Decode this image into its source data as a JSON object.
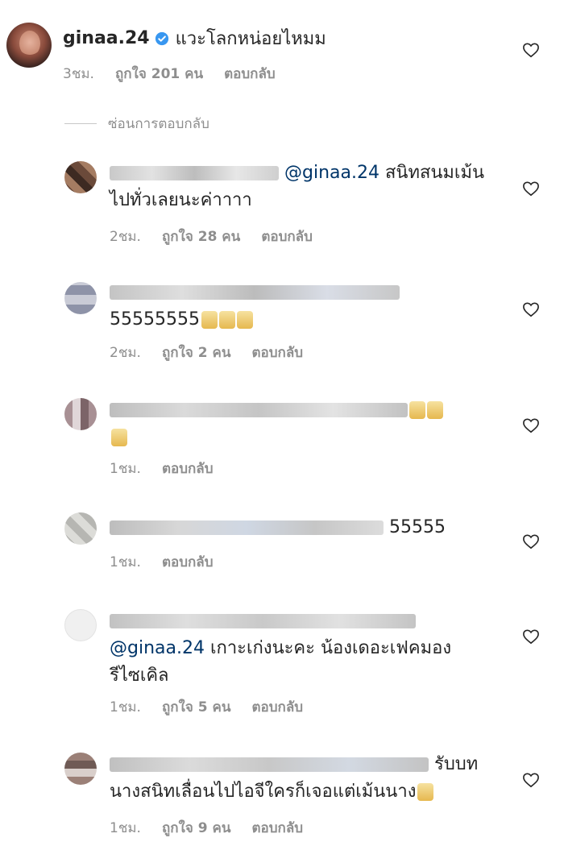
{
  "main_comment": {
    "username": "ginaa.24",
    "text": "แวะโลกหน่อยไหมม",
    "time": "3ชม.",
    "likes": "ถูกใจ 201 คน",
    "reply": "ตอบกลับ"
  },
  "hide_replies": "ซ่อนการตอบกลับ",
  "replies": [
    {
      "mention": "@ginaa.24",
      "text_line1": "สนิทสนมเม้น",
      "text_line2": "ไปทั่วเลยนะค่าาาา",
      "time": "2ชม.",
      "likes": "ถูกใจ 28 คน",
      "reply": "ตอบกลับ"
    },
    {
      "text": "55555555",
      "time": "2ชม.",
      "likes": "ถูกใจ 2 คน",
      "reply": "ตอบกลับ"
    },
    {
      "time": "1ชม.",
      "reply": "ตอบกลับ"
    },
    {
      "text": "55555",
      "time": "1ชม.",
      "reply": "ตอบกลับ"
    },
    {
      "mention": "@ginaa.24",
      "text_line1": "เกาะเก่งนะคะ น้องเดอะเฟคมอง",
      "text_line2": "รีไซเคิล",
      "time": "1ชม.",
      "likes": "ถูกใจ 5 คน",
      "reply": "ตอบกลับ"
    },
    {
      "text_line1": "รับบท",
      "text_line2": "นางสนิทเลื่อนไปไอจีใครก็เจอแต่เม้นนาง",
      "time": "1ชม.",
      "likes": "ถูกใจ 9 คน",
      "reply": "ตอบกลับ"
    }
  ],
  "colors": {
    "text": "#262626",
    "meta": "#8e8e8e",
    "mention": "#003569",
    "verified": "#3897f0"
  },
  "icons": {
    "verified": "verified-badge-icon",
    "like": "heart-outline-icon"
  }
}
